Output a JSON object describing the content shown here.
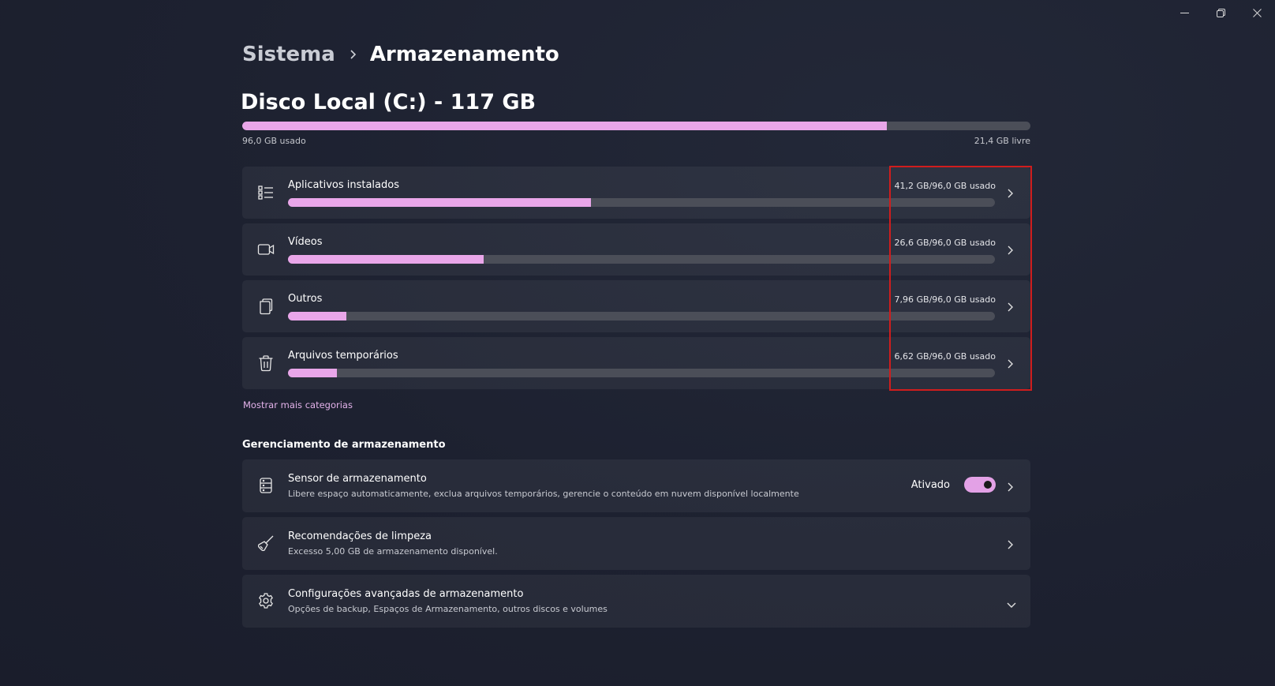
{
  "window": {
    "controls": [
      "minimize-icon",
      "restore-icon",
      "close-icon"
    ]
  },
  "breadcrumb": {
    "parent": "Sistema",
    "current": "Armazenamento"
  },
  "disk": {
    "title": "Disco Local (C:) - 117 GB",
    "used_fraction": 0.818,
    "used_label": "96,0 GB usado",
    "free_label": "21,4 GB livre"
  },
  "categories": [
    {
      "icon": "apps-list-icon",
      "label": "Aplicativos instalados",
      "usage": "41,2 GB/96,0 GB usado",
      "fraction": 0.429
    },
    {
      "icon": "video-camera-icon",
      "label": "Vídeos",
      "usage": "26,6 GB/96,0 GB usado",
      "fraction": 0.277
    },
    {
      "icon": "document-icon",
      "label": "Outros",
      "usage": "7,96 GB/96,0 GB usado",
      "fraction": 0.083
    },
    {
      "icon": "trash-icon",
      "label": "Arquivos temporários",
      "usage": "6,62 GB/96,0 GB usado",
      "fraction": 0.069
    }
  ],
  "more_categories_link": "Mostrar mais categorias",
  "management": {
    "section_title": "Gerenciamento de armazenamento",
    "items": [
      {
        "icon": "storage-sense-icon",
        "title": "Sensor de armazenamento",
        "description": "Libere espaço automaticamente, exclua arquivos temporários, gerencie o conteúdo em nuvem disponível localmente",
        "toggle_label": "Ativado",
        "toggle_on": true
      },
      {
        "icon": "broom-icon",
        "title": "Recomendações de limpeza",
        "description": "Excesso 5,00 GB de armazenamento disponível."
      },
      {
        "icon": "gear-icon",
        "title": "Configurações avançadas de armazenamento",
        "description": "Opções de backup, Espaços de Armazenamento, outros discos e volumes"
      }
    ]
  },
  "colors": {
    "accent": "#e9a6e9",
    "highlight": "#d01d1d",
    "background": "#1c2030"
  }
}
